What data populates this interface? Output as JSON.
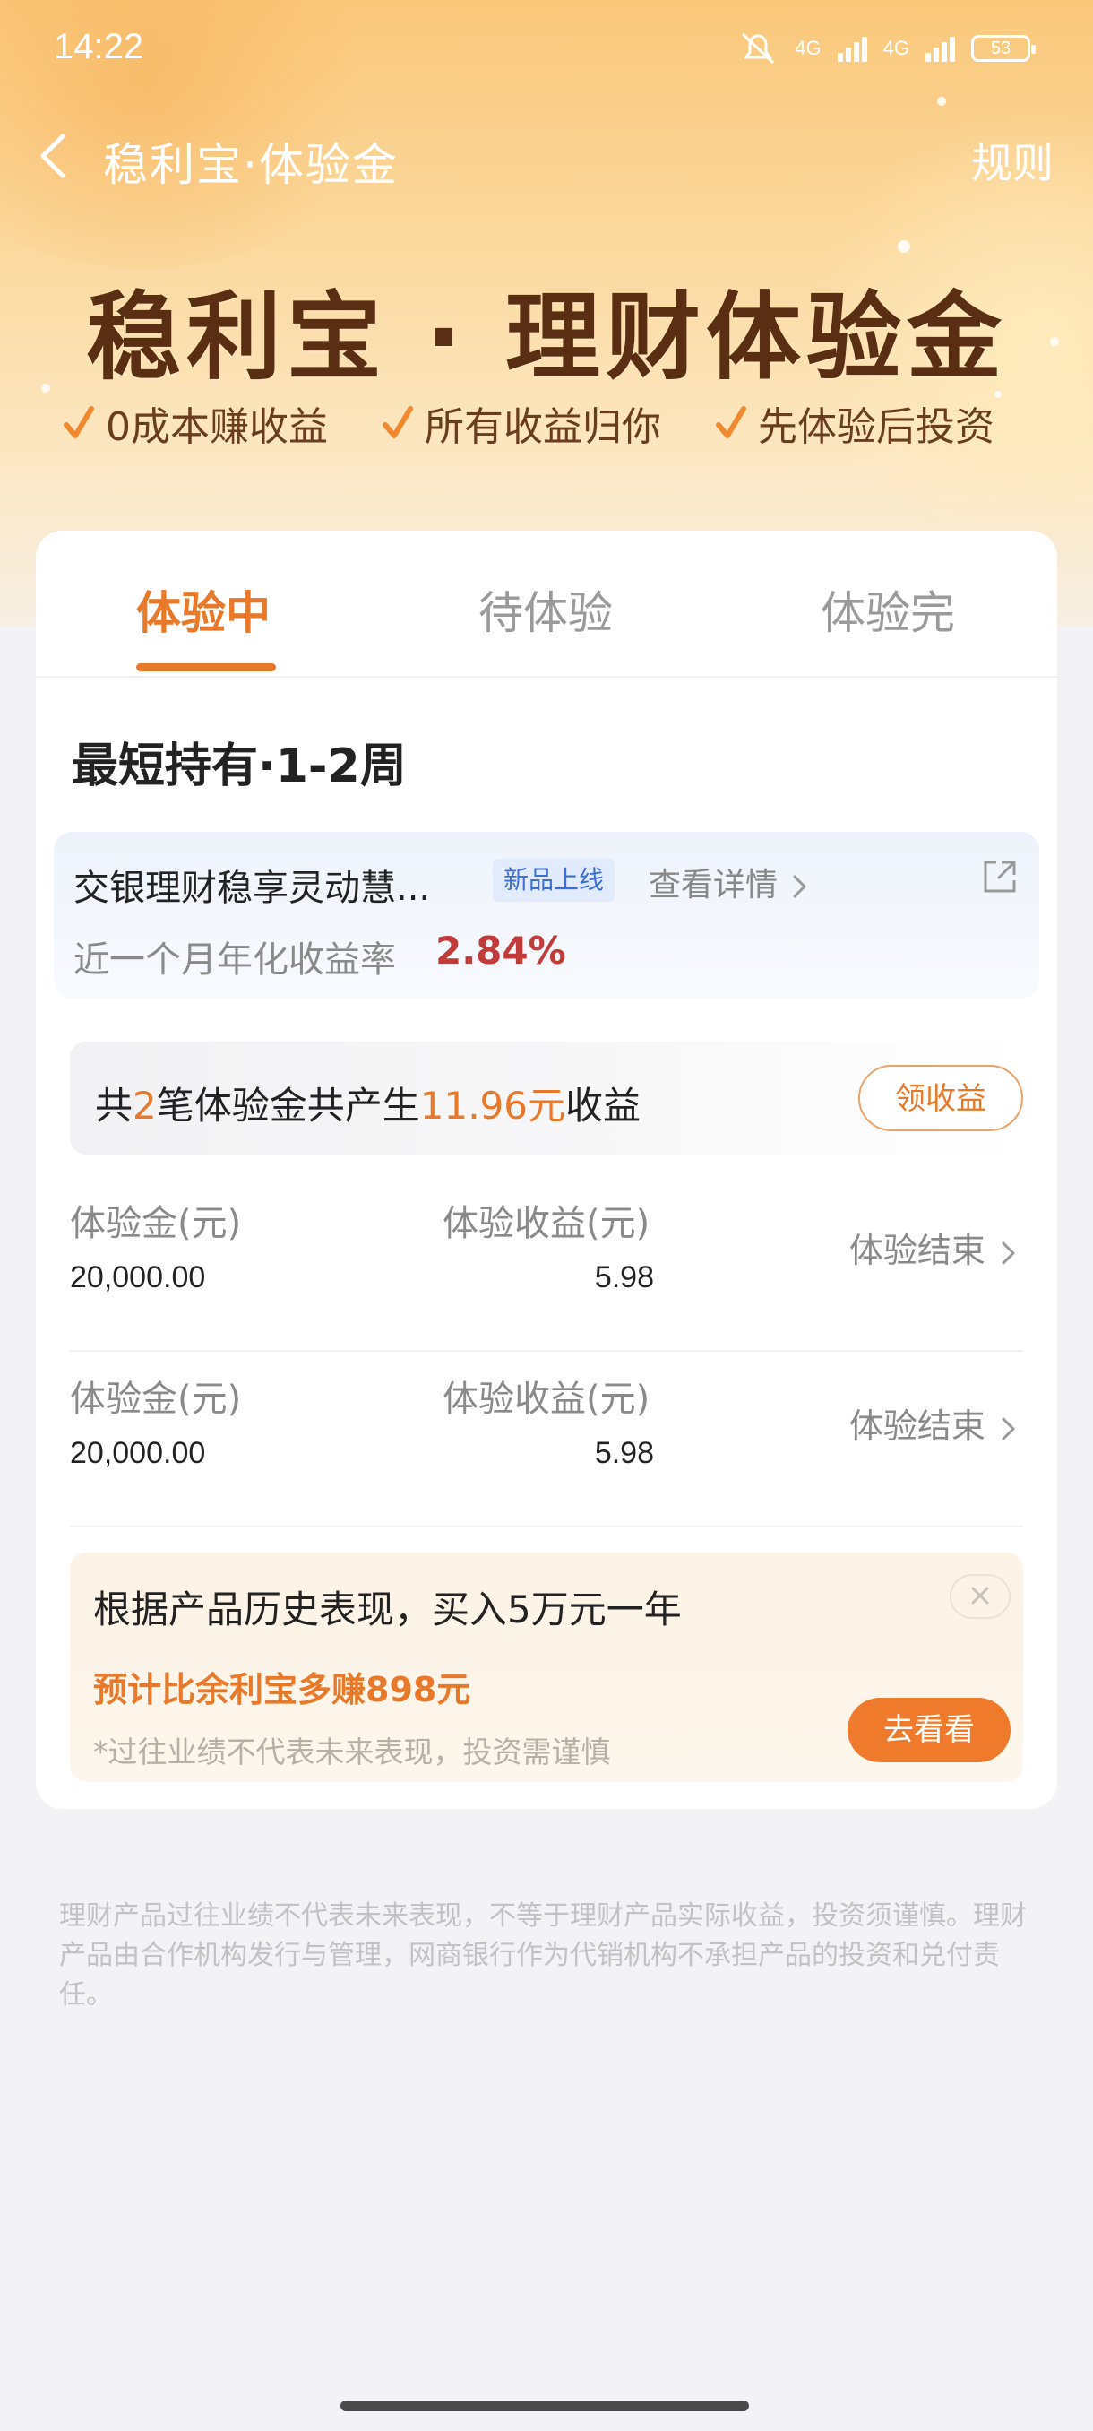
{
  "status_bar": {
    "time": "14:22",
    "network_1": "4G",
    "network_2": "4G",
    "battery": "53"
  },
  "nav": {
    "title": "稳利宝·体验金",
    "rules": "规则"
  },
  "hero": {
    "title": "稳利宝 · 理财体验金",
    "features": [
      "0成本赚收益",
      "所有收益归你",
      "先体验后投资"
    ]
  },
  "tabs": [
    {
      "label": "体验中",
      "active": true
    },
    {
      "label": "待体验",
      "active": false
    },
    {
      "label": "体验完",
      "active": false
    }
  ],
  "section": {
    "title": "最短持有·1-2周"
  },
  "product": {
    "name": "交银理财稳享灵动慧...",
    "badge": "新品上线",
    "detail_link": "查看详情",
    "rate_label": "近一个月年化收益率",
    "rate_value": "2.84%"
  },
  "summary": {
    "prefix": "共",
    "count": "2",
    "middle": "笔体验金共产生",
    "amount": "11.96元",
    "suffix": "收益",
    "claim_button": "领收益"
  },
  "experience_rows": [
    {
      "amount_label": "体验金(元)",
      "amount": "20,000.00",
      "yield_label": "体验收益(元)",
      "yield": "5.98",
      "status": "体验结束"
    },
    {
      "amount_label": "体验金(元)",
      "amount": "20,000.00",
      "yield_label": "体验收益(元)",
      "yield": "5.98",
      "status": "体验结束"
    }
  ],
  "promo": {
    "title": "根据产品历史表现，买入5万元一年",
    "subtitle": "预计比余利宝多赚898元",
    "note": "*过往业绩不代表未来表现，投资需谨慎",
    "button": "去看看"
  },
  "disclaimer": "理财产品过往业绩不代表未来表现，不等于理财产品实际收益，投资须谨慎。理财产品由合作机构发行与管理，网商银行作为代销机构不承担产品的投资和兑付责任。",
  "colors": {
    "accent": "#e8792a",
    "rate": "#c23b3b",
    "badge_blue": "#3b6fd6",
    "hero_title": "#5a2e12"
  }
}
